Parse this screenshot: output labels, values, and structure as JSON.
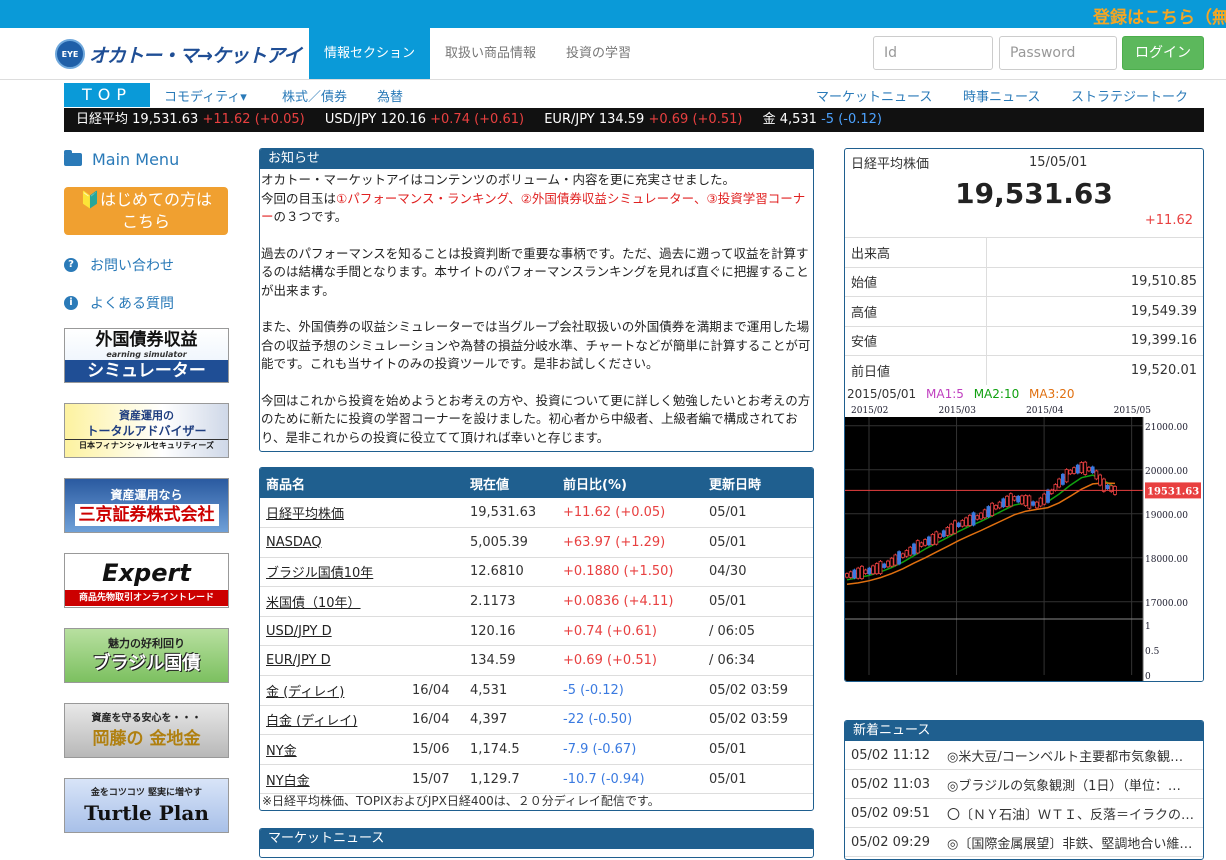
{
  "topbar": {
    "promo": "登録はこちら（無"
  },
  "header": {
    "logo_badge": "EYE",
    "logo_text": "オカトー・マ→ケットアイ",
    "tabs": [
      {
        "label": "情報セクション",
        "active": true
      },
      {
        "label": "取扱い商品情報",
        "active": false
      },
      {
        "label": "投資の学習",
        "active": false
      }
    ],
    "id_placeholder": "Id",
    "password_placeholder": "Password",
    "login_label": "ログイン"
  },
  "subnav": {
    "top_label": "TOP",
    "left": [
      "コモディティ▾",
      "株式／債券",
      "為替"
    ],
    "right": [
      "マーケットニュース",
      "時事ニュース",
      "ストラテジートーク"
    ]
  },
  "ticker": [
    {
      "name": "日経平均",
      "value": "19,531.63",
      "change": "+11.62 (+0.05)",
      "dir": "up"
    },
    {
      "name": "USD/JPY",
      "value": "120.16",
      "change": "+0.74 (+0.61)",
      "dir": "up"
    },
    {
      "name": "EUR/JPY",
      "value": "134.59",
      "change": "+0.69 (+0.51)",
      "dir": "up"
    },
    {
      "name": "金",
      "value": "4,531",
      "change": "-5 (-0.12)",
      "dir": "down"
    }
  ],
  "sidebar": {
    "main_menu": "Main Menu",
    "first_line1": "🔰はじめての方は",
    "first_line2": "こちら",
    "contact": "お問い合わせ",
    "faq": "よくある質問",
    "banners": [
      {
        "line1": "外国債券収益",
        "line2": "earning simulator",
        "line3": "シミュレーター"
      },
      {
        "line1": "資産運用の",
        "line2": "トータルアドバイザー",
        "line3": "日本フィナンシャルセキュリティーズ"
      },
      {
        "line1": "資産運用なら",
        "line2": "三京証券株式会社",
        "line3": ""
      },
      {
        "line1": "Expert",
        "line2": "商品先物取引オンライントレード",
        "line3": ""
      },
      {
        "line1": "魅力の好利回り",
        "line2": "ブラジル国債",
        "line3": ""
      },
      {
        "line1": "資産を守る安心を・・・",
        "line2": "岡藤の 金地金",
        "line3": ""
      },
      {
        "line1": "金をコツコツ 堅実に増やす",
        "line2": "Turtle Plan",
        "line3": ""
      }
    ]
  },
  "notice": {
    "title": "お知らせ",
    "p1a": "オカトー・マーケットアイはコンテンツのボリューム・内容を更に充実させました。",
    "p1b": "今回の目玉は",
    "p1red": "①パフォーマンス・ランキング、②外国債券収益シミュレーター、③投資学習コーナー",
    "p1c": "の３つです。",
    "p2": "過去のパフォーマンスを知ることは投資判断で重要な事柄です。ただ、過去に遡って収益を計算するのは結構な手間となります。本サイトのパフォーマンスランキングを見れば直ぐに把握することが出来ます。",
    "p3": "また、外国債券の収益シミュレーターでは当グループ会社取扱いの外国債券を満期まで運用した場合の収益予想のシミュレーションや為替の損益分岐水準、チャートなどが簡単に計算することが可能です。これも当サイトのみの投資ツールです。是非お試しください。",
    "p4": "今回はこれから投資を始めようとお考えの方や、投資について更に詳しく勉強したいとお考えの方のために新たに投資の学習コーナーを設けました。初心者から中級者、上級者編で構成されており、是非これからの投資に役立てて頂ければ幸いと存じます。"
  },
  "quotes": {
    "headers": [
      "商品名",
      "",
      "現在値",
      "前日比(%)",
      "更新日時"
    ],
    "rows": [
      {
        "name": "日経平均株価",
        "month": "",
        "price": "19,531.63",
        "change": "+11.62 (+0.05)",
        "dir": "up",
        "time": "05/01"
      },
      {
        "name": "NASDAQ",
        "month": "",
        "price": "5,005.39",
        "change": "+63.97 (+1.29)",
        "dir": "up",
        "time": "05/01"
      },
      {
        "name": "ブラジル国債10年",
        "month": "",
        "price": "12.6810",
        "change": "+0.1880 (+1.50)",
        "dir": "up",
        "time": "04/30"
      },
      {
        "name": "米国債（10年）",
        "month": "",
        "price": "2.1173",
        "change": "+0.0836 (+4.11)",
        "dir": "up",
        "time": "05/01"
      },
      {
        "name": "USD/JPY D",
        "month": "",
        "price": "120.16",
        "change": "+0.74 (+0.61)",
        "dir": "up",
        "time": "/ 06:05"
      },
      {
        "name": "EUR/JPY D",
        "month": "",
        "price": "134.59",
        "change": "+0.69 (+0.51)",
        "dir": "up",
        "time": "/ 06:34"
      },
      {
        "name": "金 (ディレイ)",
        "month": "16/04",
        "price": "4,531",
        "change": "-5 (-0.12)",
        "dir": "down",
        "time": "05/02 03:59"
      },
      {
        "name": "白金 (ディレイ)",
        "month": "16/04",
        "price": "4,397",
        "change": "-22 (-0.50)",
        "dir": "down",
        "time": "05/02 03:59"
      },
      {
        "name": "NY金",
        "month": "15/06",
        "price": "1,174.5",
        "change": "-7.9 (-0.67)",
        "dir": "down",
        "time": "05/01"
      },
      {
        "name": "NY白金",
        "month": "15/07",
        "price": "1,129.7",
        "change": "-10.7 (-0.94)",
        "dir": "down",
        "time": "05/01"
      }
    ],
    "footnote": "※日経平均株価、TOPIXおよびJPX日経400は、２０分ディレイ配信です。"
  },
  "market_news": {
    "title": "マーケットニュース"
  },
  "stock": {
    "name": "日経平均株価",
    "date": "15/05/01",
    "price": "19,531.63",
    "change": "+11.62",
    "rows": [
      {
        "label": "出来高",
        "value": ""
      },
      {
        "label": "始値",
        "value": "19,510.85"
      },
      {
        "label": "高値",
        "value": "19,549.39"
      },
      {
        "label": "安値",
        "value": "19,399.16"
      },
      {
        "label": "前日値",
        "value": "19,520.01"
      }
    ],
    "chart_date": "2015/05/01",
    "ma1": "MA1:5",
    "ma2": "MA2:10",
    "ma3": "MA3:20"
  },
  "chart_data": {
    "type": "line",
    "title": "",
    "x": [
      "2015/02",
      "2015/03",
      "2015/04",
      "2015/05"
    ],
    "y_ticks": [
      "21000.00",
      "20000.00",
      "19000.00",
      "18000.00",
      "17000.00"
    ],
    "volume_ticks": [
      "1",
      "0.5",
      "0"
    ],
    "current_label": "19531.63",
    "ylim": [
      16700,
      21200
    ],
    "series": [
      {
        "name": "MA1:5",
        "color": "#c040c0",
        "values": [
          17600,
          17650,
          17700,
          17780,
          17900,
          18050,
          18200,
          18350,
          18450,
          18600,
          18750,
          18850,
          18950,
          19100,
          19250,
          19350,
          19300,
          19200,
          19400,
          19700,
          19950,
          20050,
          20000,
          19650,
          19531
        ]
      },
      {
        "name": "MA2:10",
        "color": "#10a010",
        "values": [
          17500,
          17550,
          17600,
          17680,
          17780,
          17900,
          18050,
          18200,
          18330,
          18460,
          18600,
          18720,
          18830,
          18950,
          19080,
          19200,
          19250,
          19220,
          19280,
          19450,
          19650,
          19820,
          19880,
          19760,
          19600
        ]
      },
      {
        "name": "MA3:20",
        "color": "#e07010",
        "values": [
          17400,
          17430,
          17480,
          17550,
          17640,
          17750,
          17880,
          18000,
          18130,
          18260,
          18390,
          18510,
          18620,
          18740,
          18860,
          18980,
          19060,
          19100,
          19140,
          19250,
          19400,
          19560,
          19680,
          19700,
          19690
        ]
      }
    ],
    "grid": true,
    "background": "#000000",
    "colors": {
      "up": "#e84040",
      "down": "#3a7ae0"
    }
  },
  "news": {
    "title": "新着ニュース",
    "items": [
      {
        "time": "05/02 11:12",
        "text": "◎米大豆/コーンベルト主要都市気象観…"
      },
      {
        "time": "05/02 11:03",
        "text": "◎ブラジルの気象観測（1日）（単位：…"
      },
      {
        "time": "05/02 09:51",
        "text": "〇〔ＮＹ石油〕ＷＴＩ、反落＝イラクの…"
      },
      {
        "time": "05/02 09:29",
        "text": "◎〔国際金属展望〕非鉄、堅調地合い維…"
      }
    ]
  }
}
